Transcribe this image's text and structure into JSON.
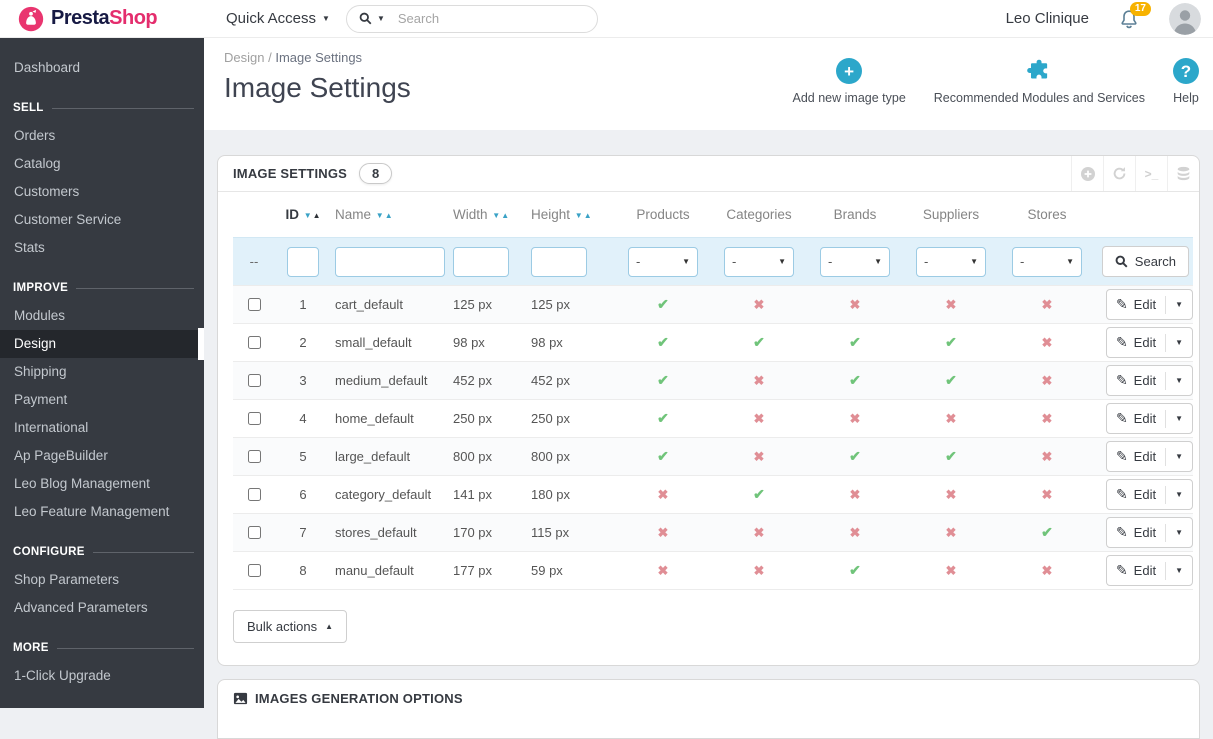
{
  "topbar": {
    "logo_presta": "Presta",
    "logo_shop": "Shop",
    "quick_access": "Quick Access",
    "search_placeholder": "Search",
    "user_name": "Leo Clinique",
    "notification_count": "17"
  },
  "sidebar": {
    "dashboard": "Dashboard",
    "sections": [
      {
        "title": "SELL",
        "items": [
          "Orders",
          "Catalog",
          "Customers",
          "Customer Service",
          "Stats"
        ]
      },
      {
        "title": "IMPROVE",
        "items": [
          "Modules",
          "Design",
          "Shipping",
          "Payment",
          "International",
          "Ap PageBuilder",
          "Leo Blog Management",
          "Leo Feature Management"
        ],
        "active": "Design"
      },
      {
        "title": "CONFIGURE",
        "items": [
          "Shop Parameters",
          "Advanced Parameters"
        ]
      },
      {
        "title": "MORE",
        "items": [
          "1-Click Upgrade"
        ]
      }
    ]
  },
  "header": {
    "breadcrumb_parent": "Design",
    "breadcrumb_separator": "/",
    "breadcrumb_current": "Image Settings",
    "title": "Image Settings",
    "actions": [
      {
        "label": "Add new image type",
        "icon": "plus-circle-icon"
      },
      {
        "label": "Recommended Modules and Services",
        "icon": "puzzle-icon"
      },
      {
        "label": "Help",
        "icon": "question-circle-icon"
      }
    ],
    "accent_color": "#2ca7ca"
  },
  "panel": {
    "title": "IMAGE SETTINGS",
    "count": "8",
    "tool_icons": [
      "add-icon",
      "refresh-icon",
      "terminal-icon",
      "sql-manager-icon"
    ],
    "table": {
      "columns": [
        "ID",
        "Name",
        "Width",
        "Height",
        "Products",
        "Categories",
        "Brands",
        "Suppliers",
        "Stores"
      ],
      "flag_columns": [
        "products",
        "categories",
        "brands",
        "suppliers",
        "stores"
      ],
      "filter": {
        "checkbox_placeholder": "--",
        "select_placeholder": "-",
        "search_label": "Search"
      },
      "edit_label": "Edit",
      "rows": [
        {
          "id": "1",
          "name": "cart_default",
          "width": "125 px",
          "height": "125 px",
          "flags": [
            true,
            false,
            false,
            false,
            false
          ]
        },
        {
          "id": "2",
          "name": "small_default",
          "width": "98 px",
          "height": "98 px",
          "flags": [
            true,
            true,
            true,
            true,
            false
          ]
        },
        {
          "id": "3",
          "name": "medium_default",
          "width": "452 px",
          "height": "452 px",
          "flags": [
            true,
            false,
            true,
            true,
            false
          ]
        },
        {
          "id": "4",
          "name": "home_default",
          "width": "250 px",
          "height": "250 px",
          "flags": [
            true,
            false,
            false,
            false,
            false
          ]
        },
        {
          "id": "5",
          "name": "large_default",
          "width": "800 px",
          "height": "800 px",
          "flags": [
            true,
            false,
            true,
            true,
            false
          ]
        },
        {
          "id": "6",
          "name": "category_default",
          "width": "141 px",
          "height": "180 px",
          "flags": [
            false,
            true,
            false,
            false,
            false
          ]
        },
        {
          "id": "7",
          "name": "stores_default",
          "width": "170 px",
          "height": "115 px",
          "flags": [
            false,
            false,
            false,
            false,
            true
          ]
        },
        {
          "id": "8",
          "name": "manu_default",
          "width": "177 px",
          "height": "59 px",
          "flags": [
            false,
            false,
            true,
            false,
            false
          ]
        }
      ]
    },
    "bulk_actions_label": "Bulk actions"
  },
  "panel2": {
    "title": "IMAGES GENERATION OPTIONS"
  },
  "glyphs": {
    "check": "✔",
    "cross": "✖",
    "caret_down": "▼",
    "caret_up": "▲",
    "pencil": "✎",
    "terminal": ">_",
    "plus": "+",
    "question": "?"
  },
  "colors": {
    "check_green": "#70c47a",
    "cross_red": "#e08e95",
    "accent_blue": "#2ca7ca",
    "brand_pink": "#e42d6d",
    "sidebar_bg": "#363a41",
    "badge_orange": "#f7b200",
    "filter_row_bg": "#e1f1fa"
  }
}
